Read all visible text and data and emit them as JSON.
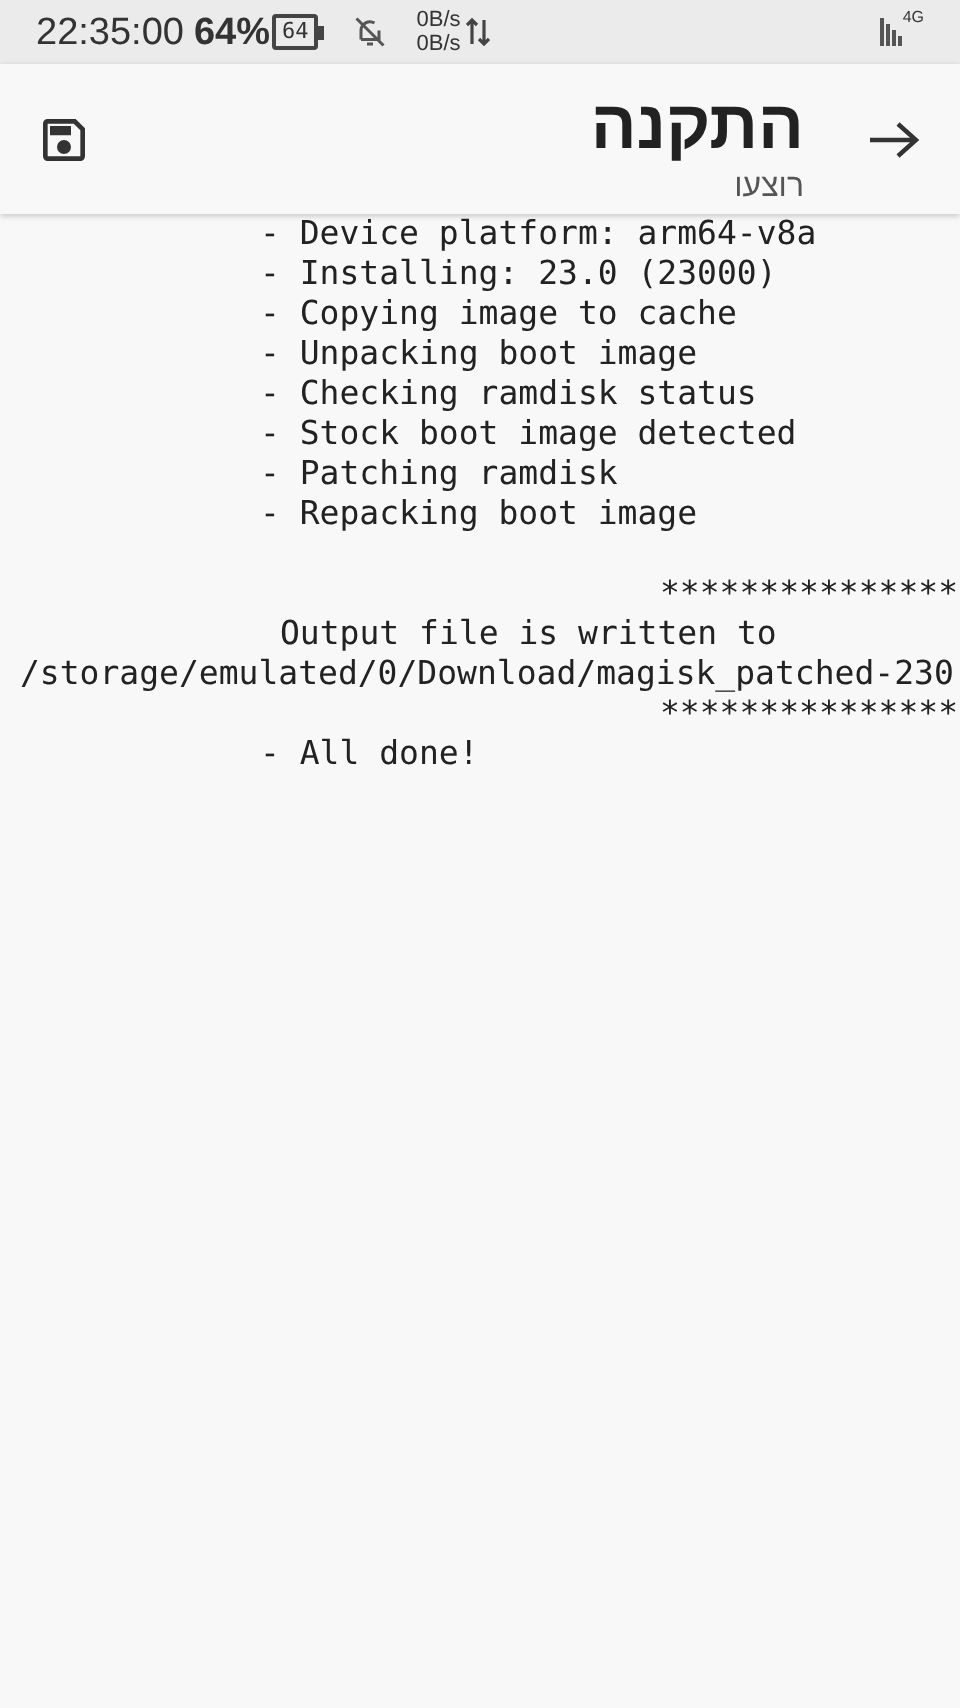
{
  "status_bar": {
    "time": "22:35:00",
    "battery_percent": "64%",
    "battery_icon_text": "64",
    "upload_speed": "0B/s",
    "download_speed": "0B/s",
    "network_type": "4G"
  },
  "header": {
    "title": "התקנה",
    "subtitle": "רוצעו"
  },
  "log": [
    {
      "kind": "step",
      "text": "- Device platform: arm64-v8a"
    },
    {
      "kind": "step",
      "text": "- Installing: 23.0 (23000)"
    },
    {
      "kind": "step",
      "text": "- Copying image to cache"
    },
    {
      "kind": "step",
      "text": "- Unpacking boot image"
    },
    {
      "kind": "step",
      "text": "- Checking ramdisk status"
    },
    {
      "kind": "step",
      "text": "- Stock boot image detected"
    },
    {
      "kind": "step",
      "text": "- Patching ramdisk"
    },
    {
      "kind": "step",
      "text": "- Repacking boot image"
    },
    {
      "kind": "blank"
    },
    {
      "kind": "rule",
      "text": "***************"
    },
    {
      "kind": "message",
      "text": "Output file is written to"
    },
    {
      "kind": "path",
      "text": "/storage/emulated/0/Download/magisk_patched-230"
    },
    {
      "kind": "rule",
      "text": "***************"
    },
    {
      "kind": "step",
      "text": "- All done!"
    }
  ]
}
